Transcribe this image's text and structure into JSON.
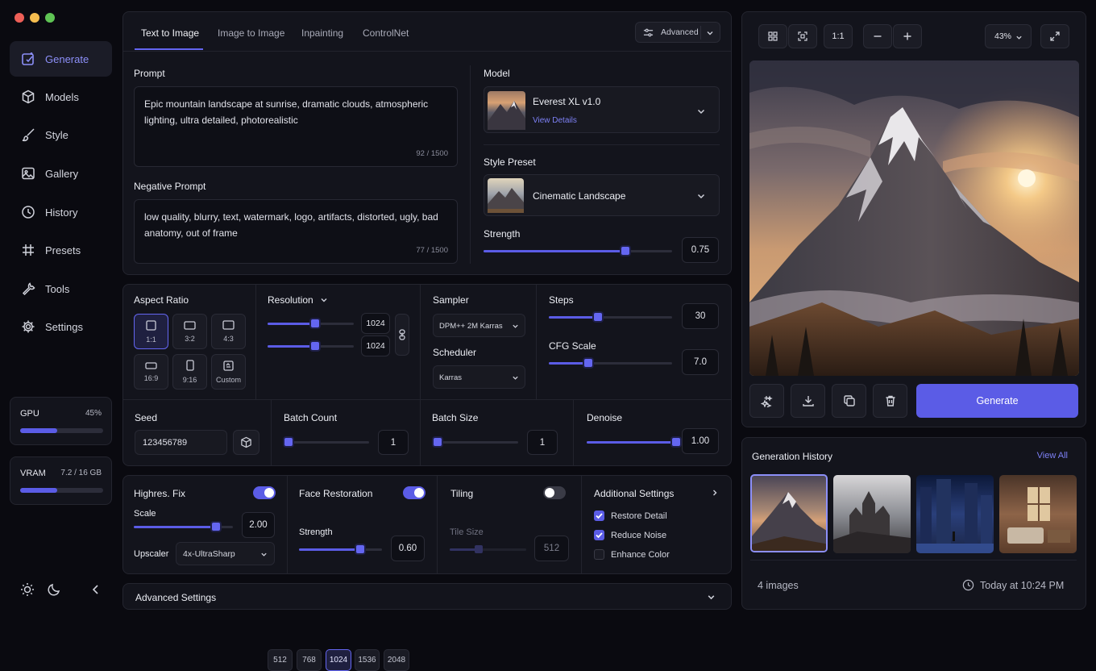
{
  "app": {
    "window_controls": [
      "close",
      "minimize",
      "maximize"
    ]
  },
  "sidebar": {
    "items": [
      {
        "label": "Generate",
        "icon": "generate-icon",
        "active": true
      },
      {
        "label": "Models",
        "icon": "cube-icon"
      },
      {
        "label": "Style",
        "icon": "brush-icon"
      },
      {
        "label": "Gallery",
        "icon": "image-icon"
      },
      {
        "label": "History",
        "icon": "clock-icon"
      },
      {
        "label": "Presets",
        "icon": "hash-icon"
      },
      {
        "label": "Tools",
        "icon": "wrench-icon"
      },
      {
        "label": "Settings",
        "icon": "gear-icon"
      }
    ],
    "gpu": {
      "label": "GPU",
      "value": "45%",
      "fraction": 0.45
    },
    "vram": {
      "label": "VRAM",
      "value": "7.2 / 16 GB",
      "fraction": 0.45
    }
  },
  "tabs": [
    {
      "label": "Text to Image",
      "active": true
    },
    {
      "label": "Image to Image"
    },
    {
      "label": "Inpainting"
    },
    {
      "label": "ControlNet"
    }
  ],
  "advanced_button": "Advanced",
  "prompt": {
    "label": "Prompt",
    "text": "Epic mountain landscape at sunrise, dramatic clouds, atmospheric lighting, ultra detailed, photorealistic",
    "count": "92 / 1500"
  },
  "negative_prompt": {
    "label": "Negative Prompt",
    "text": "low quality, blurry, text, watermark, logo, artifacts, distorted, ugly, bad anatomy, out of frame",
    "count": "77 / 1500"
  },
  "model": {
    "label": "Model",
    "name": "Everest XL v1.0",
    "link": "View Details"
  },
  "style_preset": {
    "label": "Style Preset",
    "name": "Cinematic Landscape"
  },
  "strength": {
    "label": "Strength",
    "value": "0.75",
    "fraction": 0.75
  },
  "aspect_ratio": {
    "label": "Aspect Ratio",
    "options": [
      "1:1",
      "3:2",
      "4:3",
      "16:9",
      "9:16",
      "Custom"
    ]
  },
  "resolution": {
    "label": "Resolution",
    "width": "1024",
    "height": "1024",
    "presets": [
      "512",
      "768",
      "1024",
      "1536",
      "2048"
    ],
    "active": "1024"
  },
  "sampler": {
    "label": "Sampler",
    "value": "DPM++ 2M Karras"
  },
  "scheduler": {
    "label": "Scheduler",
    "value": "Karras"
  },
  "steps": {
    "label": "Steps",
    "value": "30",
    "fraction": 0.4
  },
  "cfg": {
    "label": "CFG Scale",
    "value": "7.0",
    "fraction": 0.32
  },
  "seed": {
    "label": "Seed",
    "value": "123456789"
  },
  "batch_count": {
    "label": "Batch Count",
    "value": "1"
  },
  "batch_size": {
    "label": "Batch Size",
    "value": "1"
  },
  "denoise": {
    "label": "Denoise",
    "value": "1.00",
    "fraction": 1.0
  },
  "highres": {
    "label": "Highres. Fix",
    "on": true,
    "scale_label": "Scale",
    "scale": "2.00",
    "upscaler_label": "Upscaler",
    "upscaler": "4x-UltraSharp"
  },
  "face_restoration": {
    "label": "Face Restoration",
    "on": true,
    "strength_label": "Strength",
    "strength": "0.60"
  },
  "tiling": {
    "label": "Tiling",
    "on": false,
    "tile_label": "Tile Size",
    "tile": "512"
  },
  "additional": {
    "label": "Additional Settings",
    "options": [
      {
        "label": "Restore Detail",
        "checked": true
      },
      {
        "label": "Reduce Noise",
        "checked": true
      },
      {
        "label": "Enhance Color",
        "checked": false
      }
    ]
  },
  "advanced_settings": "Advanced Settings",
  "preview": {
    "ratio": "1:1",
    "zoom": "43%"
  },
  "generate_button": "Generate",
  "history": {
    "title": "Generation History",
    "view_all": "View All",
    "count": "4 images",
    "time": "Today at 10:24 PM"
  },
  "colors": {
    "accent": "#5b5ce6",
    "bg": "#0a0a10",
    "panel": "#13141c"
  }
}
